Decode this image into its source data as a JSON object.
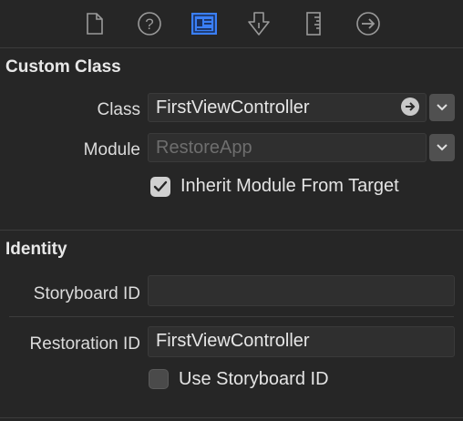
{
  "toolbar": {
    "icons": [
      "file-inspector-icon",
      "quick-help-icon",
      "identity-inspector-icon",
      "attributes-inspector-icon",
      "size-inspector-icon",
      "connections-inspector-icon"
    ],
    "selected": "identity-inspector-icon",
    "accent": "#3a7ff6"
  },
  "custom_class": {
    "title": "Custom Class",
    "class_label": "Class",
    "class_value": "FirstViewController",
    "module_label": "Module",
    "module_placeholder": "RestoreApp",
    "inherit_label": "Inherit Module From Target",
    "inherit_checked": true
  },
  "identity": {
    "title": "Identity",
    "storyboard_id_label": "Storyboard ID",
    "storyboard_id_value": "",
    "restoration_id_label": "Restoration ID",
    "restoration_id_value": "FirstViewController",
    "use_storyboard_label": "Use Storyboard ID",
    "use_storyboard_checked": false
  }
}
